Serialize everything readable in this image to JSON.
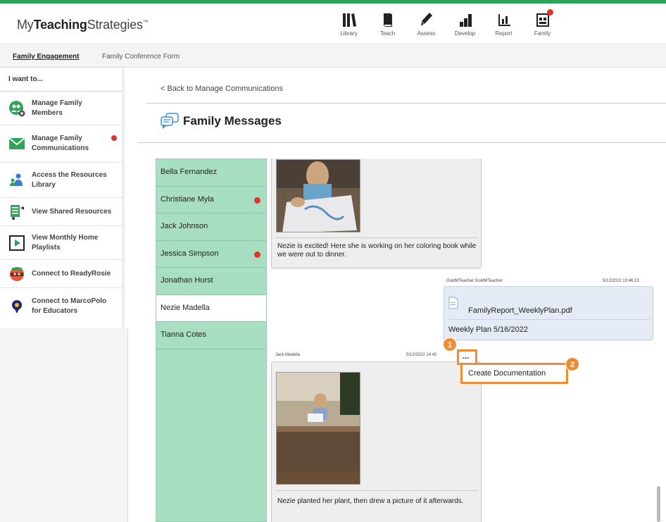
{
  "app": {
    "logo_my": "My",
    "logo_teaching": "Teaching",
    "logo_strategies": "Strategies",
    "logo_tm": "™"
  },
  "nav": {
    "items": [
      {
        "label": "Library",
        "icon": "library-icon"
      },
      {
        "label": "Teach",
        "icon": "teach-icon"
      },
      {
        "label": "Assess",
        "icon": "assess-icon"
      },
      {
        "label": "Develop",
        "icon": "develop-icon"
      },
      {
        "label": "Report",
        "icon": "report-icon"
      },
      {
        "label": "Family",
        "icon": "family-icon",
        "notification": true
      }
    ]
  },
  "subnav": {
    "tabs": [
      {
        "label": "Family Engagement",
        "active": true
      },
      {
        "label": "Family Conference Form",
        "active": false
      }
    ]
  },
  "sidebar": {
    "heading": "I want to...",
    "items": [
      {
        "label": "Manage Family Members",
        "icon": "family-members-icon"
      },
      {
        "label": "Manage Family Communications",
        "icon": "envelope-icon",
        "notification": true
      },
      {
        "label": "Access the Resources Library",
        "icon": "resources-library-icon"
      },
      {
        "label": "View Shared Resources",
        "icon": "shared-resources-icon"
      },
      {
        "label": "View Monthly Home Playlists",
        "icon": "playlist-icon"
      },
      {
        "label": "Connect to ReadyRosie",
        "icon": "readyrosie-icon"
      },
      {
        "label": "Connect to MarcoPolo for Educators",
        "icon": "marcopolo-icon"
      }
    ]
  },
  "main": {
    "back_link": "< Back to Manage Communications",
    "title": "Family Messages"
  },
  "contacts": [
    {
      "name": "Bella Fernandez",
      "unread": false,
      "active": false
    },
    {
      "name": "Christiane Myla",
      "unread": true,
      "active": false
    },
    {
      "name": "Jack Johnson",
      "unread": false,
      "active": false
    },
    {
      "name": "Jessica Simpson",
      "unread": true,
      "active": false
    },
    {
      "name": "Jonathan Hurst",
      "unread": false,
      "active": false
    },
    {
      "name": "Nezie Madella",
      "unread": false,
      "active": true
    },
    {
      "name": "Tianna Cotes",
      "unread": false,
      "active": false
    }
  ],
  "messages": {
    "msg1_text": "Nezie is excited! Here she is working on her coloring book while we were out to dinner.",
    "msg2_sender": "GoldMTeacher GoldMTeacher",
    "msg2_time": "5/12/2022 13:46:13",
    "msg2_attachment": "FamilyReport_WeeklyPlan.pdf",
    "msg2_text": "Weekly Plan 5/16/2022",
    "msg3_sender": "Jack Madella",
    "msg3_time": "5/12/2022 14:42",
    "msg3_text": "Nezie planted her plant, then drew a picture of it afterwards."
  },
  "menu": {
    "more_label": "...",
    "create_documentation": "Create Documentation"
  },
  "callouts": {
    "one": "1",
    "two": "2"
  },
  "colors": {
    "accent_green": "#2fa35a",
    "contact_bg": "#a8dfc2",
    "notification": "#e6322c",
    "callout": "#f08c32"
  }
}
